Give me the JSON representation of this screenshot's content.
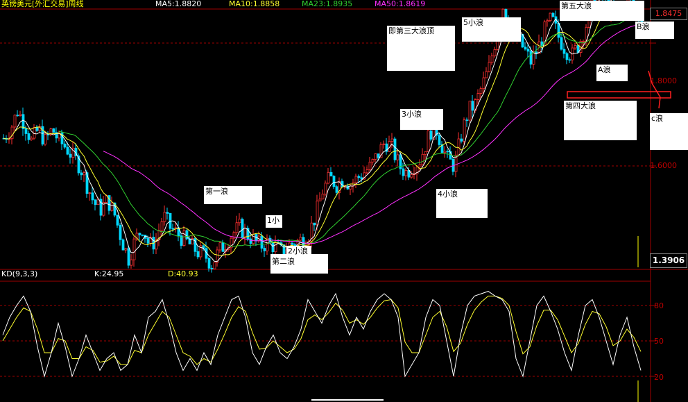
{
  "header": {
    "title": "英镑美元[外汇交易]周线",
    "ma5": "MA5:1.8820",
    "ma10": "MA10:1.8858",
    "ma23": "MA23:1.8935",
    "ma50": "MA50:1.8619"
  },
  "colors": {
    "up": "#ff3030",
    "down": "#00d8ff",
    "ma5": "#ffffff",
    "ma10": "#ffff30",
    "ma23": "#30d030",
    "ma50": "#ff30ff",
    "grid": "#a00000"
  },
  "price_axis": {
    "labels": [
      "1.8475",
      "1.8000",
      "1.6000"
    ],
    "current": "1.3906"
  },
  "kd": {
    "label": "KD(9,3,3)",
    "k": "K:24.95",
    "d": "D:40.93",
    "levels": [
      "80",
      "50",
      "20"
    ]
  },
  "annotations": [
    {
      "id": "wave1",
      "text": "第一浪"
    },
    {
      "id": "wave2",
      "text": "第二浪"
    },
    {
      "id": "wave3top",
      "text": "即第三大浪顶"
    },
    {
      "id": "w1small",
      "text": "1小"
    },
    {
      "id": "w2small",
      "text": "2小浪"
    },
    {
      "id": "w3small",
      "text": "3小浪"
    },
    {
      "id": "w4small",
      "text": "4小浪"
    },
    {
      "id": "w5small",
      "text": "5小浪"
    },
    {
      "id": "wave4",
      "text": "第四大浪"
    },
    {
      "id": "wave5",
      "text": "第五大浪"
    },
    {
      "id": "waveA",
      "text": "A浪"
    },
    {
      "id": "waveB",
      "text": "B浪"
    },
    {
      "id": "waveC",
      "text": "c浪"
    }
  ],
  "chart_data": {
    "type": "candlestick",
    "title": "英镑美元[外汇交易]周线",
    "y_ticks": [
      1.8475,
      1.8,
      1.6
    ],
    "close_path": [
      [
        0,
        1.645
      ],
      [
        10,
        1.66
      ],
      [
        20,
        1.69
      ],
      [
        30,
        1.67
      ],
      [
        40,
        1.64
      ],
      [
        50,
        1.66
      ],
      [
        60,
        1.64
      ],
      [
        70,
        1.66
      ],
      [
        80,
        1.64
      ],
      [
        90,
        1.63
      ],
      [
        100,
        1.615
      ],
      [
        110,
        1.6
      ],
      [
        120,
        1.57
      ],
      [
        130,
        1.54
      ],
      [
        140,
        1.53
      ],
      [
        150,
        1.545
      ],
      [
        160,
        1.52
      ],
      [
        170,
        1.48
      ],
      [
        180,
        1.45
      ],
      [
        190,
        1.48
      ],
      [
        200,
        1.5
      ],
      [
        210,
        1.47
      ],
      [
        220,
        1.48
      ],
      [
        230,
        1.52
      ],
      [
        240,
        1.5
      ],
      [
        250,
        1.49
      ],
      [
        260,
        1.48
      ],
      [
        270,
        1.47
      ],
      [
        280,
        1.46
      ],
      [
        290,
        1.455
      ],
      [
        300,
        1.44
      ],
      [
        310,
        1.46
      ],
      [
        320,
        1.475
      ],
      [
        330,
        1.49
      ],
      [
        340,
        1.5
      ],
      [
        350,
        1.49
      ],
      [
        360,
        1.48
      ],
      [
        370,
        1.47
      ],
      [
        380,
        1.475
      ],
      [
        390,
        1.47
      ],
      [
        400,
        1.46
      ],
      [
        410,
        1.47
      ],
      [
        420,
        1.475
      ],
      [
        430,
        1.48
      ],
      [
        440,
        1.49
      ],
      [
        450,
        1.52
      ],
      [
        460,
        1.56
      ],
      [
        470,
        1.58
      ],
      [
        480,
        1.57
      ],
      [
        490,
        1.58
      ],
      [
        500,
        1.57
      ],
      [
        510,
        1.58
      ],
      [
        520,
        1.59
      ],
      [
        530,
        1.6
      ],
      [
        540,
        1.62
      ],
      [
        550,
        1.64
      ],
      [
        560,
        1.63
      ],
      [
        570,
        1.6
      ],
      [
        580,
        1.59
      ],
      [
        590,
        1.6
      ],
      [
        600,
        1.61
      ],
      [
        610,
        1.64
      ],
      [
        620,
        1.67
      ],
      [
        630,
        1.64
      ],
      [
        640,
        1.61
      ],
      [
        650,
        1.6
      ],
      [
        660,
        1.65
      ],
      [
        670,
        1.69
      ],
      [
        680,
        1.7
      ],
      [
        690,
        1.73
      ],
      [
        700,
        1.76
      ],
      [
        710,
        1.81
      ],
      [
        720,
        1.86
      ],
      [
        730,
        1.83
      ],
      [
        740,
        1.81
      ],
      [
        750,
        1.79
      ],
      [
        760,
        1.77
      ],
      [
        770,
        1.79
      ],
      [
        780,
        1.82
      ],
      [
        790,
        1.84
      ],
      [
        800,
        1.81
      ],
      [
        810,
        1.79
      ],
      [
        820,
        1.78
      ],
      [
        830,
        1.8
      ],
      [
        840,
        1.83
      ],
      [
        850,
        1.87
      ],
      [
        860,
        1.88
      ],
      [
        870,
        1.86
      ],
      [
        880,
        1.85
      ],
      [
        890,
        1.86
      ],
      [
        900,
        1.87
      ],
      [
        910,
        1.86
      ],
      [
        920,
        1.835
      ]
    ],
    "kd_k_path": [
      [
        0,
        55
      ],
      [
        10,
        70
      ],
      [
        20,
        80
      ],
      [
        30,
        88
      ],
      [
        40,
        75
      ],
      [
        50,
        45
      ],
      [
        60,
        20
      ],
      [
        70,
        40
      ],
      [
        80,
        65
      ],
      [
        90,
        45
      ],
      [
        100,
        20
      ],
      [
        110,
        35
      ],
      [
        120,
        55
      ],
      [
        130,
        40
      ],
      [
        140,
        25
      ],
      [
        150,
        35
      ],
      [
        160,
        40
      ],
      [
        170,
        25
      ],
      [
        180,
        30
      ],
      [
        190,
        55
      ],
      [
        200,
        40
      ],
      [
        210,
        70
      ],
      [
        220,
        75
      ],
      [
        230,
        85
      ],
      [
        240,
        65
      ],
      [
        250,
        40
      ],
      [
        260,
        25
      ],
      [
        270,
        35
      ],
      [
        280,
        25
      ],
      [
        290,
        40
      ],
      [
        300,
        30
      ],
      [
        310,
        55
      ],
      [
        320,
        70
      ],
      [
        330,
        85
      ],
      [
        340,
        88
      ],
      [
        350,
        70
      ],
      [
        360,
        40
      ],
      [
        370,
        30
      ],
      [
        380,
        45
      ],
      [
        390,
        55
      ],
      [
        400,
        40
      ],
      [
        410,
        35
      ],
      [
        420,
        45
      ],
      [
        430,
        60
      ],
      [
        440,
        85
      ],
      [
        450,
        75
      ],
      [
        460,
        65
      ],
      [
        470,
        80
      ],
      [
        480,
        90
      ],
      [
        490,
        70
      ],
      [
        500,
        55
      ],
      [
        510,
        70
      ],
      [
        520,
        60
      ],
      [
        530,
        75
      ],
      [
        540,
        85
      ],
      [
        550,
        90
      ],
      [
        560,
        85
      ],
      [
        570,
        70
      ],
      [
        580,
        20
      ],
      [
        590,
        30
      ],
      [
        600,
        40
      ],
      [
        610,
        70
      ],
      [
        620,
        85
      ],
      [
        630,
        80
      ],
      [
        640,
        50
      ],
      [
        650,
        20
      ],
      [
        660,
        55
      ],
      [
        670,
        80
      ],
      [
        680,
        88
      ],
      [
        690,
        90
      ],
      [
        700,
        92
      ],
      [
        710,
        88
      ],
      [
        720,
        85
      ],
      [
        730,
        75
      ],
      [
        740,
        35
      ],
      [
        750,
        20
      ],
      [
        760,
        50
      ],
      [
        770,
        80
      ],
      [
        780,
        88
      ],
      [
        790,
        75
      ],
      [
        800,
        60
      ],
      [
        810,
        40
      ],
      [
        820,
        25
      ],
      [
        830,
        55
      ],
      [
        840,
        80
      ],
      [
        850,
        85
      ],
      [
        860,
        70
      ],
      [
        870,
        50
      ],
      [
        880,
        30
      ],
      [
        890,
        55
      ],
      [
        900,
        70
      ],
      [
        910,
        45
      ],
      [
        920,
        25
      ]
    ],
    "kd_d_path": [
      [
        0,
        50
      ],
      [
        10,
        60
      ],
      [
        20,
        70
      ],
      [
        30,
        78
      ],
      [
        40,
        75
      ],
      [
        50,
        60
      ],
      [
        60,
        40
      ],
      [
        70,
        40
      ],
      [
        80,
        52
      ],
      [
        90,
        50
      ],
      [
        100,
        35
      ],
      [
        110,
        35
      ],
      [
        120,
        45
      ],
      [
        130,
        42
      ],
      [
        140,
        32
      ],
      [
        150,
        33
      ],
      [
        160,
        37
      ],
      [
        170,
        30
      ],
      [
        180,
        30
      ],
      [
        190,
        42
      ],
      [
        200,
        40
      ],
      [
        210,
        55
      ],
      [
        220,
        65
      ],
      [
        230,
        75
      ],
      [
        240,
        70
      ],
      [
        250,
        55
      ],
      [
        260,
        40
      ],
      [
        270,
        37
      ],
      [
        280,
        30
      ],
      [
        290,
        35
      ],
      [
        300,
        32
      ],
      [
        310,
        43
      ],
      [
        320,
        56
      ],
      [
        330,
        70
      ],
      [
        340,
        79
      ],
      [
        350,
        75
      ],
      [
        360,
        57
      ],
      [
        370,
        43
      ],
      [
        380,
        44
      ],
      [
        390,
        50
      ],
      [
        400,
        45
      ],
      [
        410,
        40
      ],
      [
        420,
        43
      ],
      [
        430,
        52
      ],
      [
        440,
        68
      ],
      [
        450,
        72
      ],
      [
        460,
        68
      ],
      [
        470,
        74
      ],
      [
        480,
        82
      ],
      [
        490,
        76
      ],
      [
        500,
        65
      ],
      [
        510,
        68
      ],
      [
        520,
        64
      ],
      [
        530,
        70
      ],
      [
        540,
        78
      ],
      [
        550,
        84
      ],
      [
        560,
        85
      ],
      [
        570,
        78
      ],
      [
        580,
        49
      ],
      [
        590,
        40
      ],
      [
        600,
        40
      ],
      [
        610,
        55
      ],
      [
        620,
        70
      ],
      [
        630,
        75
      ],
      [
        640,
        62
      ],
      [
        650,
        41
      ],
      [
        660,
        48
      ],
      [
        670,
        64
      ],
      [
        680,
        76
      ],
      [
        690,
        83
      ],
      [
        700,
        88
      ],
      [
        710,
        88
      ],
      [
        720,
        86
      ],
      [
        730,
        80
      ],
      [
        740,
        58
      ],
      [
        750,
        39
      ],
      [
        760,
        45
      ],
      [
        770,
        63
      ],
      [
        780,
        76
      ],
      [
        790,
        76
      ],
      [
        800,
        68
      ],
      [
        810,
        54
      ],
      [
        820,
        40
      ],
      [
        830,
        48
      ],
      [
        840,
        64
      ],
      [
        850,
        75
      ],
      [
        860,
        73
      ],
      [
        870,
        62
      ],
      [
        880,
        46
      ],
      [
        890,
        50
      ],
      [
        900,
        60
      ],
      [
        910,
        53
      ],
      [
        920,
        41
      ]
    ],
    "kd_levels": [
      80,
      50,
      20
    ]
  }
}
